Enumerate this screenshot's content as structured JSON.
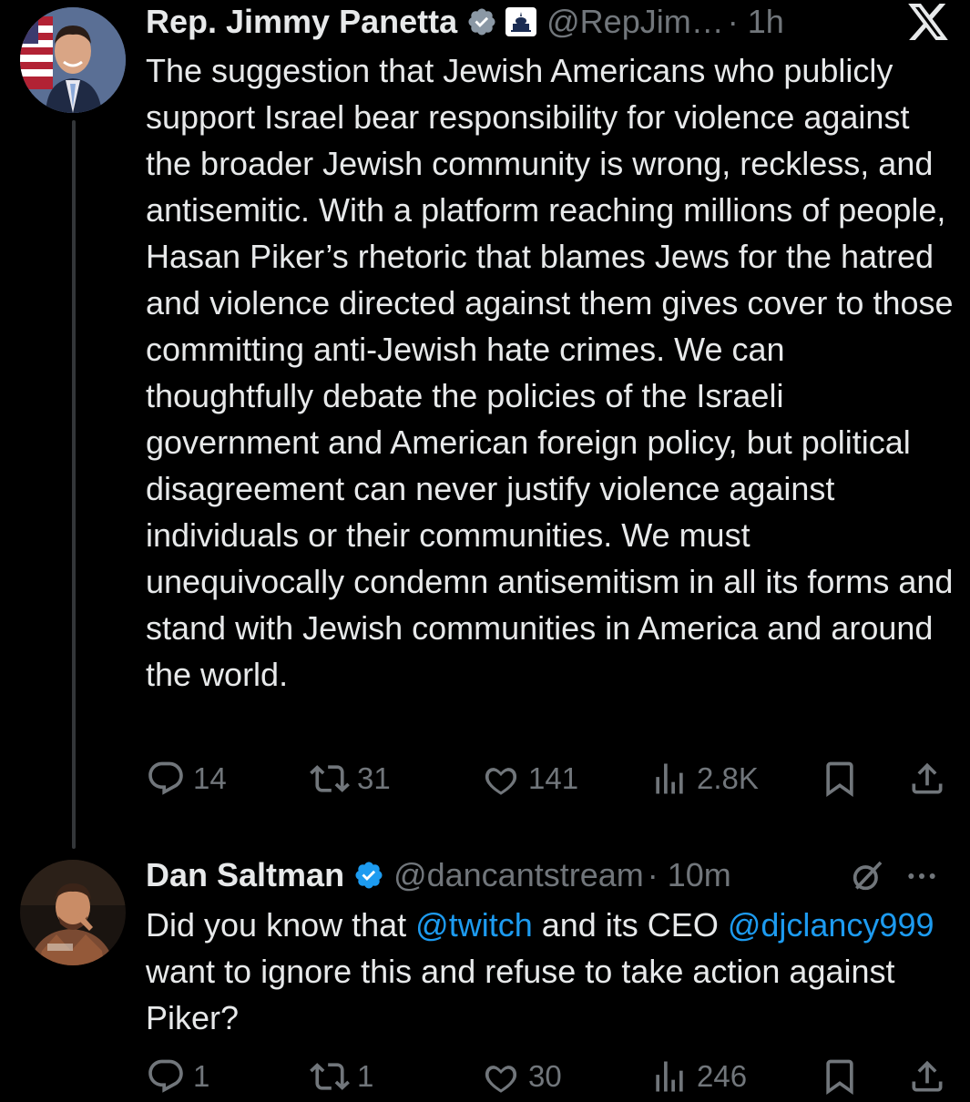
{
  "tweets": [
    {
      "name": "Rep. Jimmy Panetta",
      "handle": "@RepJim…",
      "time": "· 1h",
      "text": "The suggestion that Jewish Americans who publicly support Israel bear responsibility for violence against the broader Jewish community is wrong, reckless, and antisemitic. With a platform reaching millions of people, Hasan Piker’s rhetoric that blames Jews for the hatred and violence directed against them gives cover to those committing anti-Jewish hate crimes. We can thoughtfully debate the policies of the Israeli government and American foreign policy, but political disagreement can never justify violence against individuals or their communities. We must unequivocally condemn antisemitism in all its forms and stand with Jewish communities in America and around the world.",
      "replies": "14",
      "reposts": "31",
      "likes": "141",
      "views": "2.8K"
    },
    {
      "name": "Dan Saltman",
      "handle": "@dancantstream",
      "time": "· 10m",
      "text_parts": [
        "Did you know that ",
        "@twitch",
        " and its CEO ",
        "@djclancy999",
        " want to ignore this and refuse to take action against Piker?"
      ],
      "replies": "1",
      "reposts": "1",
      "likes": "30",
      "views": "246"
    }
  ],
  "icons": {
    "verified": "verified-badge-icon",
    "affiliate": "capitol-affiliation-icon",
    "x_logo": "x-logo-icon",
    "grok": "grok-icon",
    "more": "more-icon",
    "reply": "reply-icon",
    "repost": "repost-icon",
    "like": "like-icon",
    "views": "views-icon",
    "bookmark": "bookmark-icon",
    "share": "share-icon"
  },
  "colors": {
    "background": "#000000",
    "text": "#e7e9ea",
    "muted": "#71767b",
    "link": "#1d9bf0",
    "verified": "#1d9bf0"
  }
}
